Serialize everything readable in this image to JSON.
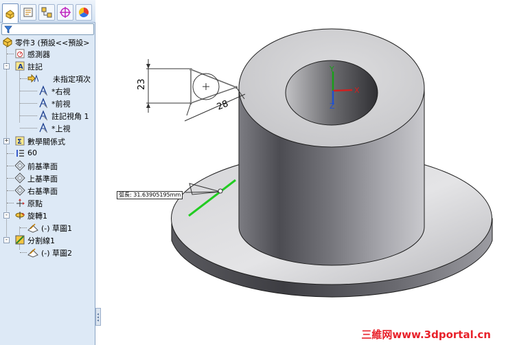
{
  "tabs": [
    {
      "name": "feature-manager",
      "icon": "feature-tree-icon"
    },
    {
      "name": "property-manager",
      "icon": "property-icon"
    },
    {
      "name": "configuration-manager",
      "icon": "configuration-icon"
    },
    {
      "name": "dimxpert-manager",
      "icon": "crosshair-icon"
    },
    {
      "name": "display-manager",
      "icon": "color-wheel-icon"
    }
  ],
  "filter": {
    "icon": "filter-icon"
  },
  "tree": {
    "root": "零件3 (預設<<預設>",
    "items": [
      {
        "label": "感測器"
      },
      {
        "label": "註記"
      },
      {
        "label": "未指定項次"
      },
      {
        "label": "*右視"
      },
      {
        "label": "*前視"
      },
      {
        "label": "註記視角 1"
      },
      {
        "label": "*上視"
      },
      {
        "label": "數學關係式"
      },
      {
        "label": "60"
      },
      {
        "label": "前基準面"
      },
      {
        "label": "上基準面"
      },
      {
        "label": "右基準面"
      },
      {
        "label": "原點"
      },
      {
        "label": "旋轉1"
      },
      {
        "label": "(-) 草圖1"
      },
      {
        "label": "分割線1"
      },
      {
        "label": "(-) 草圖2"
      }
    ]
  },
  "viewport": {
    "dim_vertical": "23",
    "dim_angled": "28",
    "triad": {
      "x": "X",
      "y": "Y",
      "z": "Z"
    },
    "arc_length": "弧長: 31.63905195mm"
  },
  "colors": {
    "panel_bg": "#dde9f6",
    "split_line": "#22cc22",
    "watermark": "#e8212a"
  },
  "watermark": "三維网www.3dportal.cn"
}
